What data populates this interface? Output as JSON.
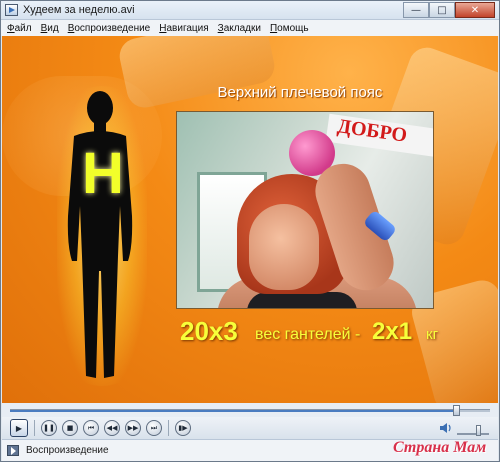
{
  "window": {
    "title": "Худеем за неделю.avi",
    "minimize_glyph": "—",
    "maximize_glyph": "□",
    "close_glyph": "✕"
  },
  "menu": {
    "items": [
      {
        "label": "Файл",
        "mnemonic": "Ф"
      },
      {
        "label": "Вид",
        "mnemonic": "В"
      },
      {
        "label": "Воспроизведение",
        "mnemonic": "В"
      },
      {
        "label": "Навигация",
        "mnemonic": "Н"
      },
      {
        "label": "Закладки",
        "mnemonic": "З"
      },
      {
        "label": "Помощь",
        "mnemonic": "П"
      }
    ]
  },
  "video": {
    "heading": "Верхний плечевой пояс",
    "silhouette_letter": "Н",
    "reps": "20х3",
    "weight_desc": "вес гантелей -",
    "weight_value": "2х1",
    "weight_unit": "кг",
    "photo_banner": "ДОБРО",
    "accent_color": "#f48a15",
    "text_color": "#f7ff3a"
  },
  "playback": {
    "seek_position_fraction": 0.93,
    "volume_fraction": 0.6,
    "buttons": [
      {
        "name": "play-button",
        "icon": "play-icon",
        "glyph": "▶"
      },
      {
        "name": "pause-button",
        "icon": "pause-icon",
        "glyph": "❚❚"
      },
      {
        "name": "stop-button",
        "icon": "stop-icon",
        "glyph": "■"
      },
      {
        "name": "previous-button",
        "icon": "skip-back-icon",
        "glyph": "⏮"
      },
      {
        "name": "rewind-button",
        "icon": "rewind-icon",
        "glyph": "◀◀"
      },
      {
        "name": "forward-button",
        "icon": "fast-forward-icon",
        "glyph": "▶▶"
      },
      {
        "name": "next-button",
        "icon": "skip-forward-icon",
        "glyph": "⏭"
      },
      {
        "name": "frame-step-button",
        "icon": "frame-step-icon",
        "glyph": "▮▶"
      }
    ]
  },
  "status": {
    "text": "Воспроизведение"
  },
  "watermark": {
    "text": "Страна Мам"
  }
}
